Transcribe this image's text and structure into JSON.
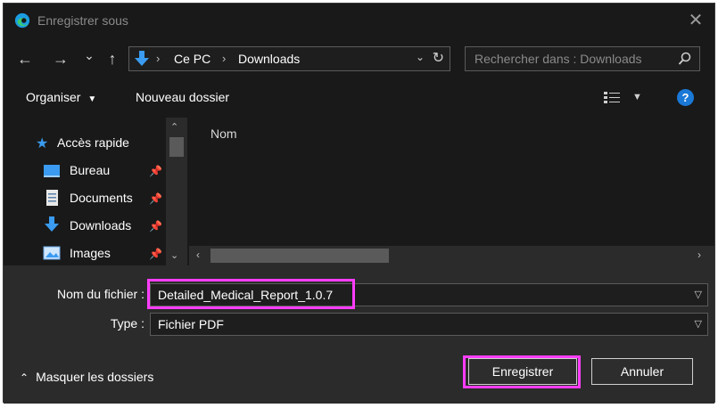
{
  "window": {
    "title": "Enregistrer sous",
    "icon": "edge-browser-icon"
  },
  "nav": {
    "back": "←",
    "forward": "→",
    "recent": "⌄",
    "up": "↑",
    "breadcrumbs": [
      "Ce PC",
      "Downloads"
    ],
    "search_placeholder": "Rechercher dans : Downloads"
  },
  "toolbar": {
    "organize": "Organiser",
    "new_folder": "Nouveau dossier",
    "help": "?"
  },
  "sidebar": {
    "items": [
      {
        "label": "Accès rapide",
        "icon": "star-icon"
      },
      {
        "label": "Bureau",
        "icon": "desktop-icon",
        "pinned": true
      },
      {
        "label": "Documents",
        "icon": "document-icon",
        "pinned": true
      },
      {
        "label": "Downloads",
        "icon": "download-icon",
        "pinned": true
      },
      {
        "label": "Images",
        "icon": "images-icon",
        "pinned": true
      }
    ]
  },
  "content": {
    "column_name": "Nom"
  },
  "form": {
    "filename_label": "Nom du fichier :",
    "filename_value": "Detailed_Medical_Report_1.0.7",
    "type_label": "Type :",
    "type_value": "Fichier PDF"
  },
  "footer": {
    "hide_folders": "Masquer les dossiers",
    "save": "Enregistrer",
    "cancel": "Annuler"
  },
  "colors": {
    "highlight": "#ff3dfb",
    "accent": "#1a78d6",
    "background": "#191919"
  }
}
